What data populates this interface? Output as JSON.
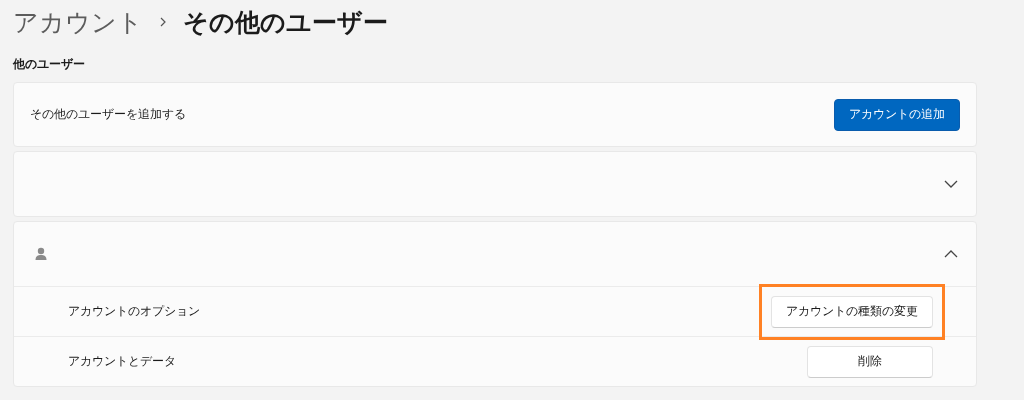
{
  "breadcrumb": [
    {
      "label": "アカウント",
      "current": false
    },
    {
      "label": "その他のユーザー",
      "current": true
    }
  ],
  "section_title": "他のユーザー",
  "add_user": {
    "label": "その他のユーザーを追加する",
    "button": {
      "label": "アカウントの追加",
      "kind": "primary"
    }
  },
  "users": [
    {
      "expanded": false,
      "has_avatar": false
    },
    {
      "expanded": true,
      "has_avatar": true,
      "rows": [
        {
          "label": "アカウントのオプション",
          "button": "アカウントの種類の変更",
          "highlighted": true
        },
        {
          "label": "アカウントとデータ",
          "button": "削除",
          "highlighted": false
        }
      ]
    }
  ]
}
